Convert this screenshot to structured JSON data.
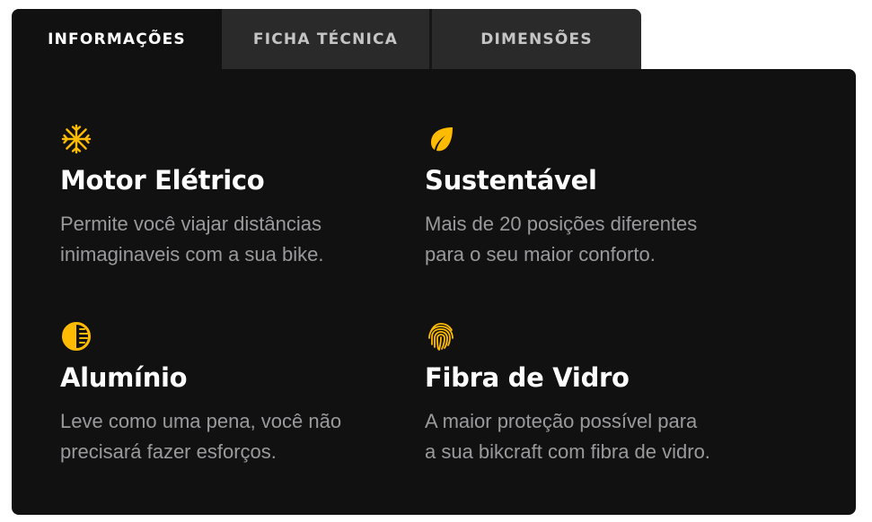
{
  "tabs": [
    {
      "label": "INFORMAÇÕES",
      "active": true
    },
    {
      "label": "FICHA TÉCNICA",
      "active": false
    },
    {
      "label": "DIMENSÕES",
      "active": false
    }
  ],
  "accent_color": "#ffbb00",
  "features": [
    {
      "icon": "snowflake-icon",
      "title": "Motor Elétrico",
      "desc_line1": "Permite você viajar distâncias",
      "desc_line2": "inimaginaveis com a sua bike."
    },
    {
      "icon": "leaf-icon",
      "title": "Sustentável",
      "desc_line1": "Mais de 20 posições diferentes",
      "desc_line2": "para o seu maior conforto."
    },
    {
      "icon": "contrast-icon",
      "title": "Alumínio",
      "desc_line1": "Leve como uma pena, você não",
      "desc_line2": "precisará fazer esforços."
    },
    {
      "icon": "fingerprint-icon",
      "title": "Fibra de Vidro",
      "desc_line1": "A maior proteção possível para",
      "desc_line2": "a sua bikcraft com fibra de vidro."
    }
  ]
}
